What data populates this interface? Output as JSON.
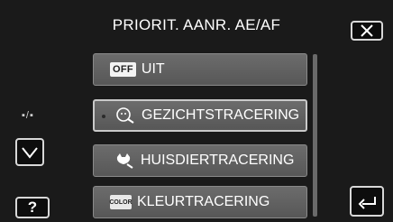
{
  "header": {
    "title": "PRIORIT. AANR. AE/AF"
  },
  "side": {
    "indicator": "▪/▪"
  },
  "options": [
    {
      "badge": "OFF",
      "label": "UIT"
    },
    {
      "label": "GEZICHTSTRACERING"
    },
    {
      "label": "HUISDIERTRACERING"
    },
    {
      "badge": "COLOR",
      "label": "KLEURTRACERING"
    }
  ],
  "buttons": {
    "help": "?"
  },
  "icons": {
    "close": "close-icon",
    "down": "chevron-down-icon",
    "back": "back-arrow-icon",
    "face": "face-tracking-icon",
    "pet": "pet-tracking-icon"
  }
}
